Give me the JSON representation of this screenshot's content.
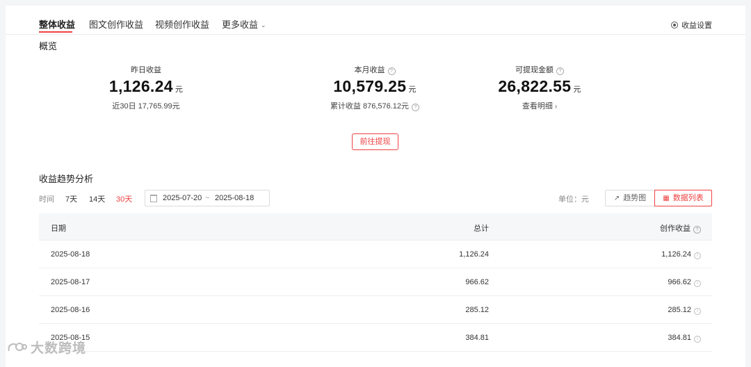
{
  "tabs": [
    {
      "label": "整体收益",
      "active": true
    },
    {
      "label": "图文创作收益",
      "active": false
    },
    {
      "label": "视频创作收益",
      "active": false
    },
    {
      "label": "更多收益",
      "active": false
    }
  ],
  "settings_label": "收益设置",
  "overview": {
    "title": "概览",
    "yesterday": {
      "label": "昨日收益",
      "value": "1,126.24",
      "unit": "元",
      "sub": "近30日 17,765.99元"
    },
    "month": {
      "label": "本月收益",
      "value": "10,579.25",
      "unit": "元",
      "sub": "累计收益 876,576.12元"
    },
    "withdrawable": {
      "label": "可提现金额",
      "value": "26,822.55",
      "unit": "元",
      "sub": "查看明细"
    }
  },
  "withdraw_button": "前往提现",
  "trend": {
    "title": "收益趋势分析",
    "time_label": "时间",
    "ranges": [
      "7天",
      "14天",
      "30天"
    ],
    "active_range": "30天",
    "date_start": "2025-07-20",
    "date_sep": "~",
    "date_end": "2025-08-18",
    "unit_label": "单位：元",
    "view_trend": "趋势图",
    "view_list": "数据列表"
  },
  "table": {
    "headers": {
      "date": "日期",
      "total": "总计",
      "income": "创作收益"
    },
    "rows": [
      {
        "date": "2025-08-18",
        "total": "1,126.24",
        "income": "1,126.24"
      },
      {
        "date": "2025-08-17",
        "total": "966.62",
        "income": "966.62"
      },
      {
        "date": "2025-08-16",
        "total": "285.12",
        "income": "285.12"
      },
      {
        "date": "2025-08-15",
        "total": "384.81",
        "income": "384.81"
      }
    ]
  },
  "watermark": "大数跨境",
  "colors": {
    "accent": "#f04142"
  }
}
